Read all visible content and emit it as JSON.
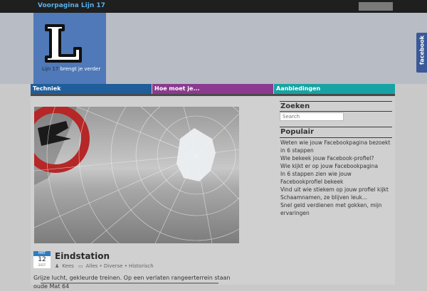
{
  "topbar": {
    "home_link": "Voorpagina Lijn 17"
  },
  "logo": {
    "letter": "L",
    "tagline_highlight": "Lijn 17",
    "tagline_rest": " brengt je verder"
  },
  "facebook": {
    "label": "facebook"
  },
  "nav": [
    {
      "label": "Techniek"
    },
    {
      "label": "Hoe moet je..."
    },
    {
      "label": "Aanbiedingen"
    }
  ],
  "post": {
    "date": {
      "month": "MRT",
      "day": "12",
      "year": "2017"
    },
    "title": "Eindstation",
    "meta": {
      "author": "Kees",
      "categories": "Alles • Diverse • Historisch"
    },
    "excerpt": "Grijze lucht, gekleurde treinen. Op een verlaten rangeerterrein staan oude Mat 64"
  },
  "sidebar": {
    "search": {
      "heading": "Zoeken",
      "placeholder": "Search"
    },
    "popular": {
      "heading": "Populair",
      "items": [
        "Weten wie jouw Facebookpagina bezoekt in 6 stappen",
        "Wie bekeek jouw Facebook-profiel?",
        "Wie kijkt er op jouw Facebookpagina",
        "In 6 stappen zien wie jouw Facebookprofiel bekeek",
        "Vind uit wie stiekem op jouw profiel kijkt",
        "Schaamnamen, ze blijven leuk...",
        "Snel geld verdienen met gokken, mijn ervaringen"
      ]
    }
  },
  "colors": {
    "nav1": "#1f5d9b",
    "nav2": "#8b3a8f",
    "nav3": "#17a3a3",
    "logo_bg": "#4f79b8",
    "facebook": "#3b5998"
  }
}
